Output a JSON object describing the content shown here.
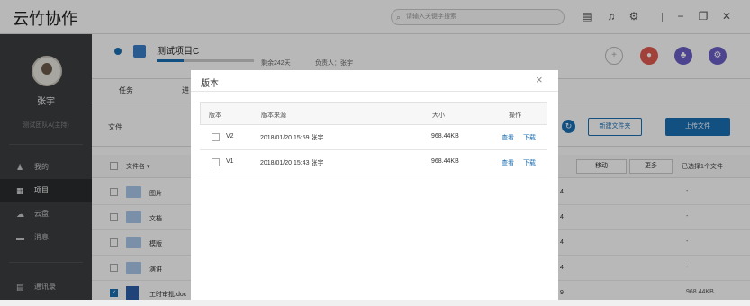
{
  "app": {
    "title": "云竹协作"
  },
  "search": {
    "placeholder": "请输入关键字搜索"
  },
  "user": {
    "name": "张宇",
    "team": "测试团队A(主持)"
  },
  "nav": [
    {
      "label": "我的",
      "icon": "person-icon"
    },
    {
      "label": "项目",
      "icon": "project-icon"
    },
    {
      "label": "云盘",
      "icon": "cloud-icon"
    },
    {
      "label": "消息",
      "icon": "message-icon"
    },
    {
      "label": "通讯录",
      "icon": "contacts-icon"
    }
  ],
  "project": {
    "name": "测试项目C",
    "progress": 0.28,
    "days_left": "剩余242天",
    "owner": "负责人：张宇"
  },
  "tabs": [
    "任务",
    "进"
  ],
  "files": {
    "section_label": "文件",
    "new_folder": "新建文件夹",
    "upload": "上传文件",
    "col_name": "文件名 ▾",
    "move": "移动",
    "more": "更多",
    "selected_info": "已选择1个文件",
    "rows": [
      {
        "name": "图片",
        "size": "4",
        "extra": "-"
      },
      {
        "name": "文档",
        "size": "4",
        "extra": "-"
      },
      {
        "name": "模版",
        "size": "4",
        "extra": "-"
      },
      {
        "name": "演讲",
        "size": "4",
        "extra": "-"
      },
      {
        "name": "工时审批.doc",
        "size": "9",
        "extra": "968.44KB"
      }
    ]
  },
  "modal": {
    "title": "版本",
    "columns": {
      "version": "版本",
      "source": "版本来源",
      "size": "大小",
      "actions": "操作"
    },
    "rows": [
      {
        "version": "V2",
        "source": "2018/01/20 15:59 张宇",
        "size": "968.44KB",
        "view": "查看",
        "download": "下载"
      },
      {
        "version": "V1",
        "source": "2018/01/20 15:43 张宇",
        "size": "968.44KB",
        "view": "查看",
        "download": "下载"
      }
    ]
  },
  "colors": {
    "accent": "#1a6fb5",
    "sidebar": "#3b3d40",
    "red": "#e05a4f",
    "purple": "#6b5fc7"
  }
}
